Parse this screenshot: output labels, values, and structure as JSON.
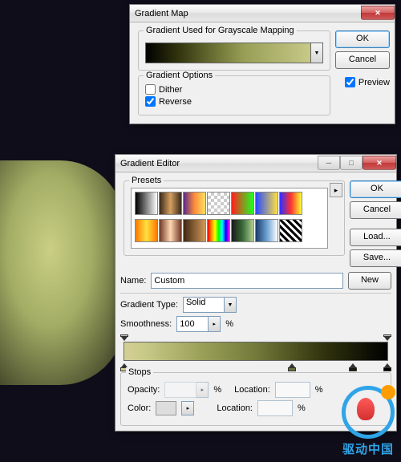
{
  "d1": {
    "title": "Gradient Map",
    "group1": "Gradient Used for Grayscale Mapping",
    "group2": "Gradient Options",
    "dither": "Dither",
    "reverse": "Reverse",
    "ok": "OK",
    "cancel": "Cancel",
    "preview": "Preview"
  },
  "d2": {
    "title": "Gradient Editor",
    "presets": "Presets",
    "ok": "OK",
    "cancel": "Cancel",
    "load": "Load...",
    "save": "Save...",
    "name_lbl": "Name:",
    "name_val": "Custom",
    "new": "New",
    "type_lbl": "Gradient Type:",
    "type_val": "Solid",
    "smooth_lbl": "Smoothness:",
    "smooth_val": "100",
    "pct": "%",
    "stops": "Stops",
    "opacity": "Opacity:",
    "location": "Location:",
    "color": "Color:"
  },
  "swatches": [
    "linear-gradient(90deg,#000,#fff)",
    "linear-gradient(90deg,#3a2a1a,#d4a060,#3a2a1a)",
    "linear-gradient(90deg,#5a2a8a,#ff8c3a,#ffe060)",
    "repeating-conic-gradient(#ccc 0 25%,#fff 0 50%) 0 0/8px 8px",
    "linear-gradient(90deg,#ff2020,#20ff20)",
    "linear-gradient(90deg,#2a4aff,#ffe040)",
    "linear-gradient(90deg,#3030ff,#ff3030,#ffff30)",
    "linear-gradient(90deg,#ff7a00,#ffe040,#ff7a00)",
    "linear-gradient(90deg,#703828,#ffd8b0,#703828)",
    "linear-gradient(90deg,#402814,#d09858)",
    "linear-gradient(90deg,#ff0000,#ff8800,#ffff00,#00ff00,#00ffff,#0000ff,#ff00ff)",
    "linear-gradient(90deg,#1a1a1a,#3a6a3a,#b0d090)",
    "linear-gradient(90deg,#1a3a6a,#6aa0d0,#fff)",
    "repeating-linear-gradient(45deg,#000 0 3px,#fff 3px 6px)"
  ],
  "watermark": "驱动中国"
}
